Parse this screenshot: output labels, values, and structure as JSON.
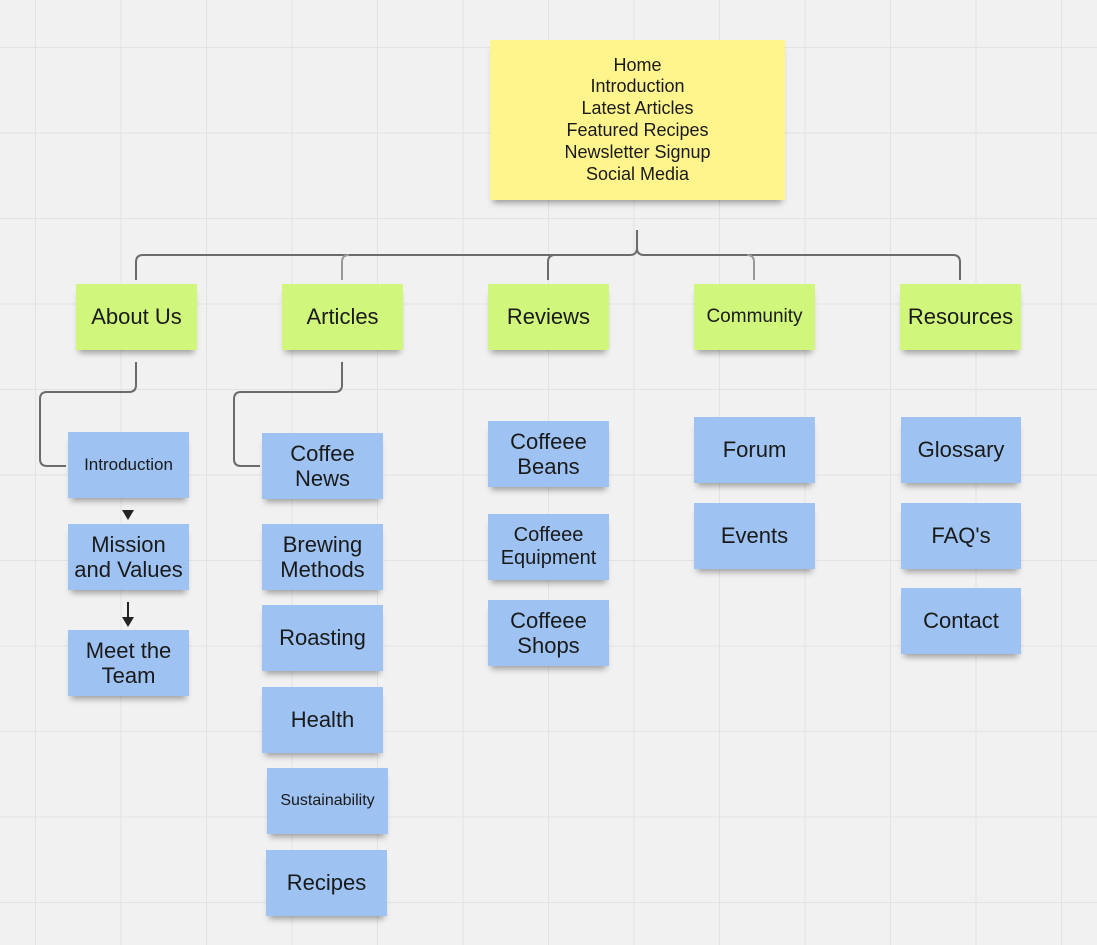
{
  "home": {
    "lines": [
      "Home",
      "Introduction",
      "Latest Articles",
      "Featured Recipes",
      "Newsletter Signup",
      "Social Media"
    ]
  },
  "sections": [
    {
      "label": "About Us",
      "children": [
        "Introduction",
        "Mission and Values",
        "Meet the Team"
      ]
    },
    {
      "label": "Articles",
      "children": [
        "Coffee News",
        "Brewing Methods",
        "Roasting",
        "Health",
        "Sustainability",
        "Recipes"
      ]
    },
    {
      "label": "Reviews",
      "children": [
        "Coffeee Beans",
        "Coffeee Equipment",
        "Coffeee Shops"
      ]
    },
    {
      "label": "Community",
      "children": [
        "Forum",
        "Events"
      ]
    },
    {
      "label": "Resources",
      "children": [
        "Glossary",
        "FAQ's",
        "Contact"
      ]
    }
  ],
  "colors": {
    "home": "#fff58c",
    "section": "#d1f67c",
    "page": "#9ec3f2",
    "connector": "#6b6b6b"
  }
}
